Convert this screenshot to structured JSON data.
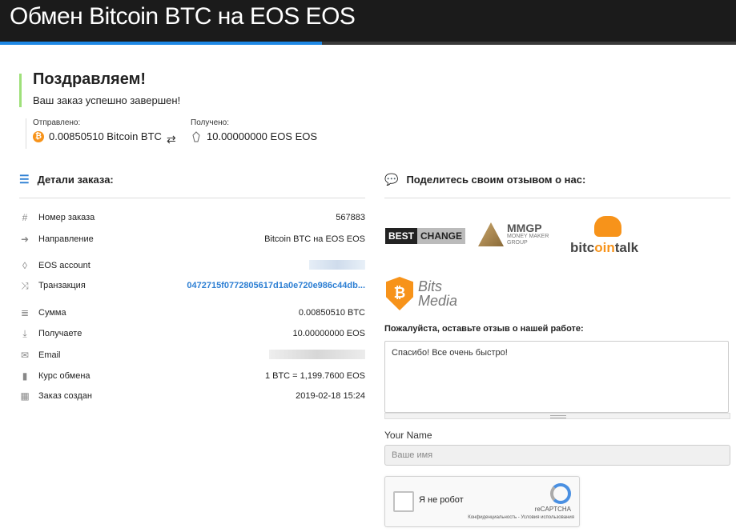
{
  "header": {
    "title": "Обмен Bitcoin BTC на EOS EOS"
  },
  "congrats": {
    "heading": "Поздравляем!",
    "subtitle": "Ваш заказ успешно завершен!"
  },
  "sent": {
    "label": "Отправлено:",
    "amount": "0.00850510 Bitcoin BTC"
  },
  "received": {
    "label": "Получено:",
    "amount": "10.00000000 EOS EOS"
  },
  "details": {
    "title": "Детали заказа:",
    "rows": [
      {
        "icon": "hash-icon",
        "label": "Номер заказа",
        "value": "567883"
      },
      {
        "icon": "direction-icon",
        "label": "Направление",
        "value": "Bitcoin BTC на EOS EOS"
      },
      {
        "icon": "eos-icon",
        "label": "EOS account",
        "value": ""
      },
      {
        "icon": "shuffle-icon",
        "label": "Транзакция",
        "value": "0472715f0772805617d1a0e720e986c44db..."
      },
      {
        "icon": "coins-icon",
        "label": "Сумма",
        "value": "0.00850510 BTC"
      },
      {
        "icon": "download-icon",
        "label": "Получаете",
        "value": "10.00000000 EOS"
      },
      {
        "icon": "envelope-icon",
        "label": "Email",
        "value": ""
      },
      {
        "icon": "bar-chart-icon",
        "label": "Курс обмена",
        "value": "1 BTC = 1,199.7600 EOS"
      },
      {
        "icon": "calendar-icon",
        "label": "Заказ создан",
        "value": "2019-02-18 15:24"
      }
    ]
  },
  "feedback": {
    "title": "Поделитесь своим отзывом о нас:",
    "logos": {
      "bestchange_a": "BEST",
      "bestchange_b": "CHANGE",
      "mmgp": "MMGP",
      "mmgp_sub1": "MONEY MAKER",
      "mmgp_sub2": "GROUP",
      "bitcointalk_a": "bitc",
      "bitcointalk_b": "oin",
      "bitcointalk_c": "talk",
      "bits1": "Bits",
      "bits2": "Media"
    },
    "review_label": "Пожалуйста, оставьте отзыв о нашей работе:",
    "review_text": "Спасибо! Все очень быстро!",
    "name_label": "Your Name",
    "name_placeholder": "Ваше имя",
    "captcha_label": "Я не робот",
    "captcha_brand": "reCAPTCHA",
    "captcha_terms": "Конфиденциальность - Условия использования"
  },
  "colors": {
    "accent": "#1e88e5",
    "link": "#2d7fd3",
    "success": "#9ee07a",
    "bitcoin": "#f7931a"
  }
}
